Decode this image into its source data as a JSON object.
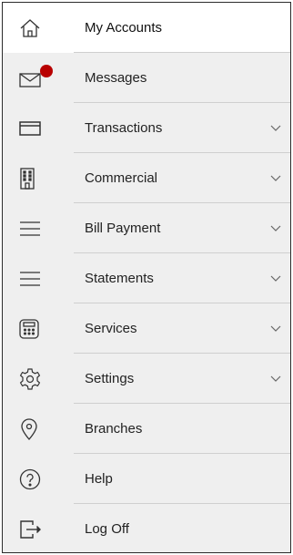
{
  "menu": {
    "items": [
      {
        "label": "My Accounts",
        "icon": "home-icon"
      },
      {
        "label": "Messages",
        "icon": "envelope-icon"
      },
      {
        "label": "Transactions",
        "icon": "card-icon"
      },
      {
        "label": "Commercial",
        "icon": "building-icon"
      },
      {
        "label": "Bill Payment",
        "icon": "lines-icon"
      },
      {
        "label": "Statements",
        "icon": "lines-icon"
      },
      {
        "label": "Services",
        "icon": "calculator-icon"
      },
      {
        "label": "Settings",
        "icon": "gear-icon"
      },
      {
        "label": "Branches",
        "icon": "location-pin-icon"
      },
      {
        "label": "Help",
        "icon": "help-icon"
      },
      {
        "label": "Log Off",
        "icon": "logout-icon"
      }
    ],
    "active_item": "My Accounts",
    "expandable_items": [
      "Transactions",
      "Commercial",
      "Bill Payment",
      "Statements",
      "Services",
      "Settings"
    ]
  },
  "colors": {
    "active_bg": "#ffffff",
    "menu_bg": "#efefef",
    "badge": "#b80000",
    "icon_stroke": "#333333"
  }
}
